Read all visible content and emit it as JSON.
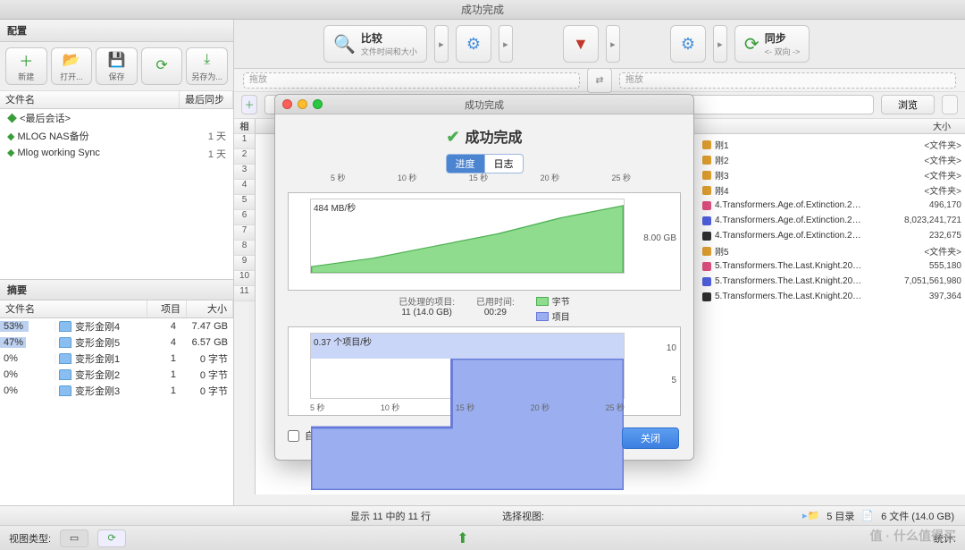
{
  "app": {
    "title": "成功完成"
  },
  "left": {
    "config_label": "配置",
    "toolbar": [
      {
        "icon": "plus-icon",
        "label": "新建"
      },
      {
        "icon": "open-icon",
        "label": "打开..."
      },
      {
        "icon": "save-icon",
        "label": "保存"
      },
      {
        "icon": "refresh-icon",
        "label": ""
      },
      {
        "icon": "saveas-icon",
        "label": "另存为..."
      }
    ],
    "cols": {
      "name": "文件名",
      "lastsync": "最后同步"
    },
    "items": [
      {
        "name": "<最后会话>",
        "sync": ""
      },
      {
        "name": "MLOG NAS备份",
        "sync": "1 天"
      },
      {
        "name": "Mlog working Sync",
        "sync": "1 天"
      }
    ],
    "summary_label": "摘要",
    "summary_cols": {
      "name": "文件名",
      "items": "项目",
      "size": "大小"
    },
    "summary_rows": [
      {
        "pct": "53%",
        "pctv": 53,
        "name": "变形金刚4",
        "items": "4",
        "size": "7.47 GB"
      },
      {
        "pct": "47%",
        "pctv": 47,
        "name": "变形金刚5",
        "items": "4",
        "size": "6.57 GB"
      },
      {
        "pct": "0%",
        "pctv": 0,
        "name": "变形金刚1",
        "items": "1",
        "size": "0 字节"
      },
      {
        "pct": "0%",
        "pctv": 0,
        "name": "变形金刚2",
        "items": "1",
        "size": "0 字节"
      },
      {
        "pct": "0%",
        "pctv": 0,
        "name": "变形金刚3",
        "items": "1",
        "size": "0 字节"
      }
    ]
  },
  "top_toolbar": {
    "compare": {
      "title": "比较",
      "sub": "文件时间和大小"
    },
    "filter": {
      "title": ""
    },
    "sync": {
      "title": "同步",
      "sub": "<- 双向 ->"
    }
  },
  "drop": {
    "left": "拖放",
    "right": "拖放",
    "browse": "浏览",
    "rel": "相"
  },
  "file_table": {
    "size_header": "大小",
    "rows": [
      {
        "icon": "#e0a030",
        "name": "刚1",
        "size": "<文件夹>"
      },
      {
        "icon": "#e0a030",
        "name": "刚2",
        "size": "<文件夹>"
      },
      {
        "icon": "#e0a030",
        "name": "刚3",
        "size": "<文件夹>"
      },
      {
        "icon": "#e0a030",
        "name": "刚4",
        "size": "<文件夹>"
      },
      {
        "icon": "#e05080",
        "name": "4.Transformers.Age.of.Extinction.2…",
        "size": "496,170"
      },
      {
        "icon": "#5060e0",
        "name": "4.Transformers.Age.of.Extinction.2…",
        "size": "8,023,241,721"
      },
      {
        "icon": "#303030",
        "name": "4.Transformers.Age.of.Extinction.2…",
        "size": "232,675"
      },
      {
        "icon": "#e0a030",
        "name": "刚5",
        "size": "<文件夹>"
      },
      {
        "icon": "#e05080",
        "name": "5.Transformers.The.Last.Knight.20…",
        "size": "555,180"
      },
      {
        "icon": "#5060e0",
        "name": "5.Transformers.The.Last.Knight.20…",
        "size": "7,051,561,980"
      },
      {
        "icon": "#303030",
        "name": "5.Transformers.The.Last.Knight.20…",
        "size": "397,364"
      }
    ]
  },
  "chart_data": [
    {
      "type": "area",
      "title": "484 MB/秒",
      "x": [
        5,
        10,
        15,
        20,
        25
      ],
      "xunit": "秒",
      "ylabel_right": "8.00 GB",
      "series": [
        {
          "name": "字节",
          "values": [
            0,
            1.5,
            3.2,
            4.7,
            6.3,
            8.0
          ]
        }
      ],
      "ylim": [
        0,
        8.0
      ]
    },
    {
      "type": "area",
      "title": "0.37 个项目/秒",
      "x": [
        5,
        10,
        15,
        20,
        25
      ],
      "xunit": "秒",
      "ylabel_right_values": [
        "10",
        "5"
      ],
      "series": [
        {
          "name": "项目",
          "values": [
            5,
            5,
            5,
            11,
            11,
            11
          ]
        }
      ],
      "ylim": [
        0,
        12
      ]
    }
  ],
  "modal": {
    "title": "成功完成",
    "heading": "成功完成",
    "tabs": {
      "progress": "进度",
      "log": "日志"
    },
    "xticks": [
      "5 秒",
      "10 秒",
      "15 秒",
      "20 秒",
      "25 秒"
    ],
    "chart1_title": "484 MB/秒",
    "chart1_right": "8.00 GB",
    "chart2_title": "0.37 个项目/秒",
    "chart2_right_top": "10",
    "chart2_right_bot": "5",
    "processed_label": "已处理的项目:",
    "processed_value": "11  (14.0 GB)",
    "time_label": "已用时间:",
    "time_value": "00:29",
    "legend": {
      "bytes": "字节",
      "items": "项目"
    },
    "autoclose": "自动关闭",
    "close": "关闭"
  },
  "status": {
    "rows": "显示 11 中的 11 行",
    "select_view": "选择视图:",
    "totals": "统计:",
    "dirs": "5 目录",
    "files": "6 文件  (14.0 GB)",
    "view_label": "视图类型:"
  },
  "watermark": "值 · 什么值得买"
}
